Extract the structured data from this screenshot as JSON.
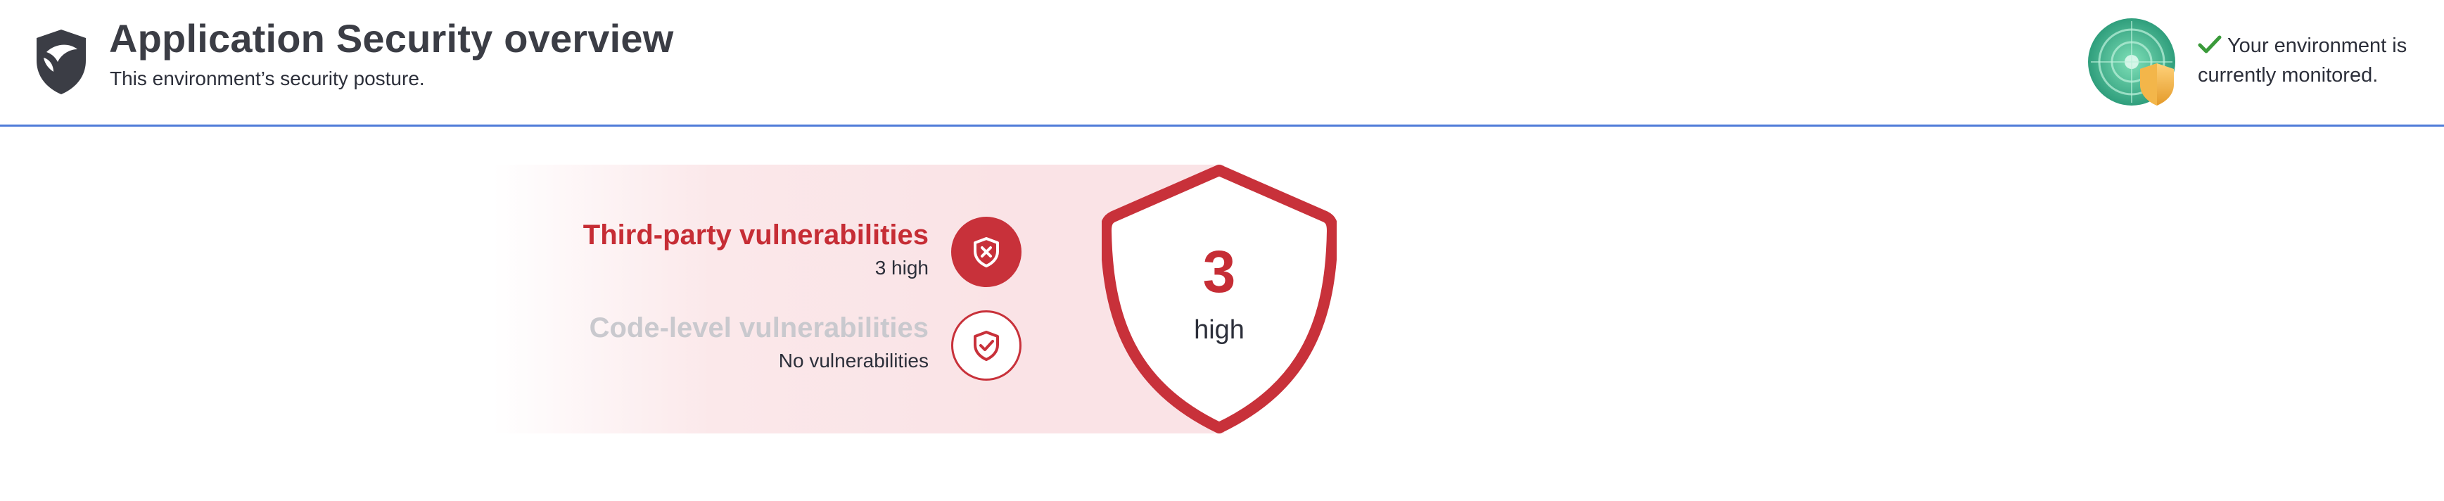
{
  "header": {
    "title": "Application Security overview",
    "subtitle": "This environment’s security posture.",
    "app_icon": "app-security-shield-icon",
    "status_icon": "radar-shield-icon",
    "status_check_icon": "check-icon",
    "status_text": "Your environment is currently monitored."
  },
  "summary": {
    "third_party": {
      "title": "Third-party vulnerabilities",
      "detail": "3 high",
      "icon": "shield-x-icon"
    },
    "code_level": {
      "title": "Code-level vulnerabilities",
      "detail": "No vulnerabilities",
      "icon": "shield-check-icon"
    },
    "shield": {
      "count": "3",
      "label": "high"
    }
  },
  "colors": {
    "accent_red": "#c8313a",
    "divider_blue": "#4f7bd8",
    "muted_text": "#c9c9ce",
    "check_green": "#3a9a3a"
  }
}
